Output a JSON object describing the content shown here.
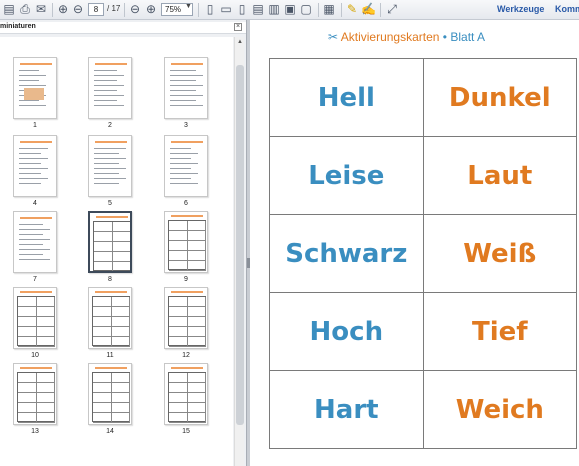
{
  "toolbar": {
    "current_page": "8",
    "page_total": "/ 17",
    "zoom": "75%",
    "tools_label": "Werkzeuge",
    "comment_label": "Komm"
  },
  "panel": {
    "title": "miniaturen"
  },
  "thumbnails": [
    {
      "label": "1",
      "kind": "text"
    },
    {
      "label": "2",
      "kind": "text"
    },
    {
      "label": "3",
      "kind": "text"
    },
    {
      "label": "4",
      "kind": "text"
    },
    {
      "label": "5",
      "kind": "text"
    },
    {
      "label": "6",
      "kind": "text"
    },
    {
      "label": "7",
      "kind": "text"
    },
    {
      "label": "8",
      "kind": "cards",
      "selected": true
    },
    {
      "label": "9",
      "kind": "cards"
    },
    {
      "label": "10",
      "kind": "cards"
    },
    {
      "label": "11",
      "kind": "cards"
    },
    {
      "label": "12",
      "kind": "cards"
    },
    {
      "label": "13",
      "kind": "cards"
    },
    {
      "label": "14",
      "kind": "cards"
    },
    {
      "label": "15",
      "kind": "cards"
    }
  ],
  "document": {
    "header_title": "Aktivierungskarten",
    "header_separator": "•",
    "header_sheet": "Blatt A",
    "cards": [
      {
        "left": "Hell",
        "right": "Dunkel"
      },
      {
        "left": "Leise",
        "right": "Laut"
      },
      {
        "left": "Schwarz",
        "right": "Weiß"
      },
      {
        "left": "Hoch",
        "right": "Tief"
      },
      {
        "left": "Hart",
        "right": "Weich"
      }
    ]
  },
  "colors": {
    "left_word": "#3a8ec0",
    "right_word": "#e07a20",
    "toolbar_link": "#2a5aa8"
  }
}
